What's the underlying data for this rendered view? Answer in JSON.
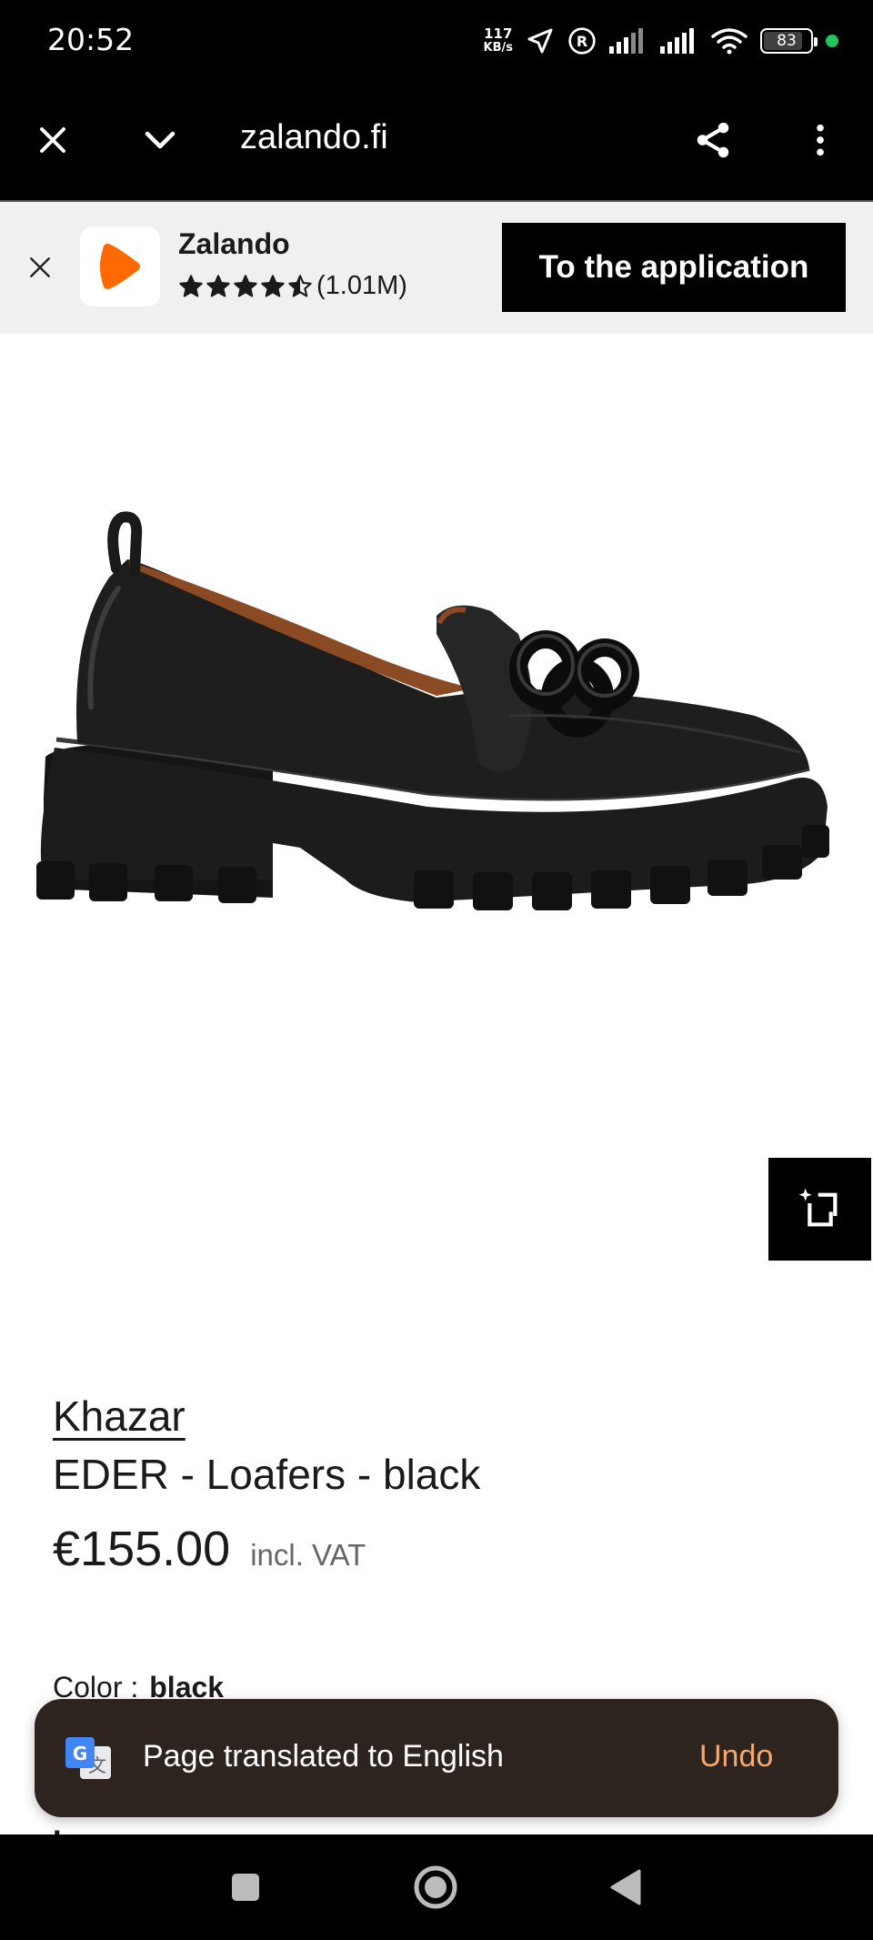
{
  "status_bar": {
    "time": "20:52",
    "net_speed_value": "117",
    "net_speed_unit": "KB/s",
    "battery": "83",
    "battery_fraction": 0.83
  },
  "browser": {
    "url": "zalando.fi"
  },
  "app_banner": {
    "app_name": "Zalando",
    "rating_text": "(1.01M)",
    "rating_stars": 4.5,
    "cta_label": "To the application",
    "brand_color": "#ff6900"
  },
  "product": {
    "brand": "Khazar",
    "name": "EDER - Loafers - black",
    "price": "€155.00",
    "vat_note": "incl. VAT",
    "color_label": "Color :",
    "color_value": "black",
    "partial_heading": "L"
  },
  "toast": {
    "message": "Page translated to English",
    "action": "Undo",
    "action_color": "#f5a86e"
  },
  "icons": {
    "close": "close-icon",
    "tabs": "chevron-down-icon",
    "share": "share-icon",
    "menu": "more-vert-icon",
    "find_similar": "find-similar-icon",
    "translate": "google-translate-icon"
  }
}
